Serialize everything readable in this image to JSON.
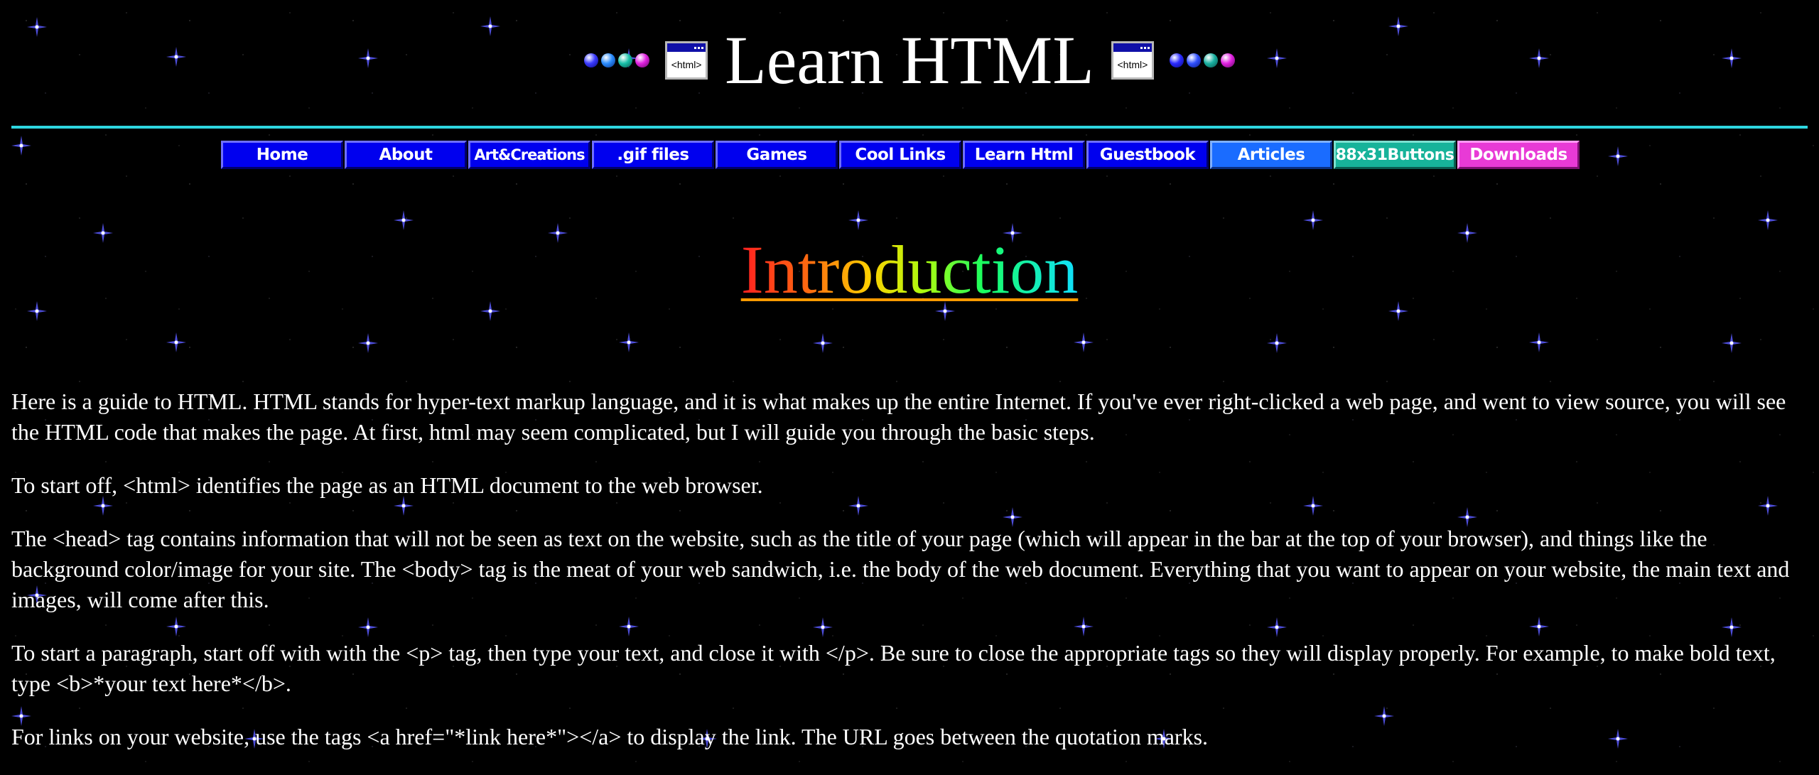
{
  "header": {
    "title": "Learn HTML",
    "html_icon_text": "<html>",
    "left_dots": [
      "#3a3aff",
      "#2a8cff",
      "#18c0a8",
      "#e020e0"
    ],
    "right_dots": [
      "#2a2aff",
      "#3050ff",
      "#18b0a0",
      "#e020e0"
    ]
  },
  "colors": {
    "rule": "#2ed6e0",
    "nav_default": "#0000ee",
    "nav_articles": "#1a6cff",
    "nav_88x31": "#17b39a",
    "nav_downloads": "#e83ad6"
  },
  "nav": {
    "home": "Home",
    "about": "About",
    "art": "Art&Creations",
    "gif": ".gif files",
    "games": "Games",
    "cool": "Cool Links",
    "learn": "Learn Html",
    "guestbook": "Guestbook",
    "articles": "Articles",
    "buttons88": "88x31Buttons",
    "downloads": "Downloads"
  },
  "section": {
    "heading": "Introduction"
  },
  "paragraphs": {
    "p1": "Here is a guide to HTML. HTML stands for hyper-text markup language, and it is what makes up the entire Internet. If you've ever right-clicked a web page, and went to view source, you will see the HTML code that makes the page. At first, html may seem complicated, but I will guide you through the basic steps.",
    "p2": "To start off, <html> identifies the page as an HTML document to the web browser.",
    "p3": "The <head> tag contains information that will not be seen as text on the website, such as the title of your page (which will appear in the bar at the top of your browser), and things like the background color/image for your site. The <body> tag is the meat of your web sandwich, i.e. the body of the web document. Everything that you want to appear on your website, the main text and images, will come after this.",
    "p4": "To start a paragraph, start off with with the <p> tag, then type your text, and close it with </p>. Be sure to close the appropriate tags so they will display properly. For example, to make bold text, type <b>*your text here*</b>.",
    "p5": "For links on your website, use the tags <a href=\"*link here*\"></a> to display the link. The URL goes between the quotation marks."
  }
}
